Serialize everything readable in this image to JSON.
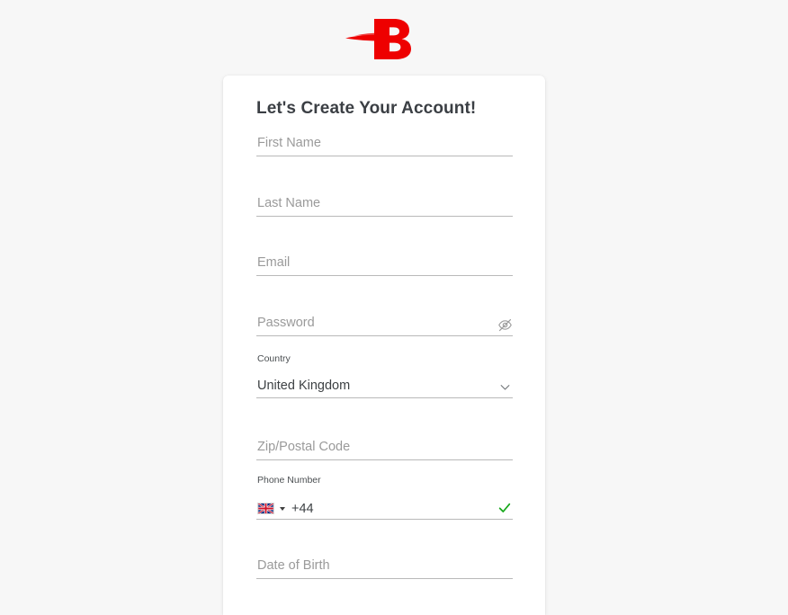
{
  "brand": {
    "logo_icon": "letter-b-swoosh-logo",
    "logo_text": "B",
    "logo_color": "#ee0000"
  },
  "card": {
    "title": "Let's Create Your Account!"
  },
  "form": {
    "fields": [
      {
        "name": "first-name",
        "placeholder": "First Name",
        "value": "",
        "label": ""
      },
      {
        "name": "last-name",
        "placeholder": "Last Name",
        "value": "",
        "label": ""
      },
      {
        "name": "email",
        "placeholder": "Email",
        "value": "",
        "label": ""
      },
      {
        "name": "password",
        "placeholder": "Password",
        "value": "",
        "label": "",
        "trailing_icon": "eye-off-icon"
      },
      {
        "name": "country",
        "placeholder": "",
        "value": "United Kingdom",
        "label": "Country",
        "trailing_icon": "chevron-down-icon"
      },
      {
        "name": "zip-postal-code",
        "placeholder": "Zip/Postal Code",
        "value": "",
        "label": ""
      },
      {
        "name": "phone-number",
        "placeholder": "",
        "value": "+44",
        "label": "Phone Number",
        "flag_icon": "uk-flag-icon",
        "trailing_icon": "valid-check-icon"
      },
      {
        "name": "date-of-birth",
        "placeholder": "Date of Birth",
        "value": "",
        "label": ""
      }
    ],
    "valid_check_color": "#16a81b"
  }
}
